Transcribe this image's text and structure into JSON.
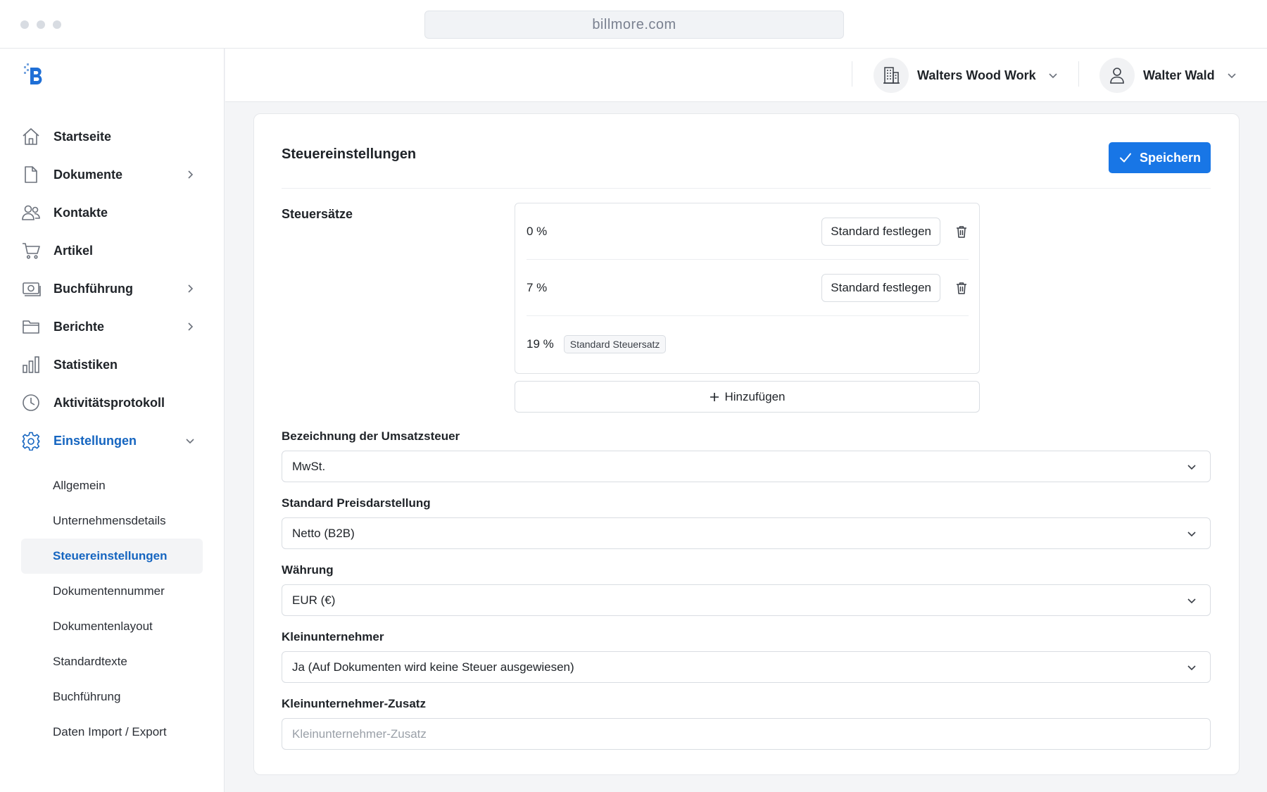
{
  "browser": {
    "url": "billmore.com"
  },
  "sidebar": {
    "logo": "billmore-logo",
    "items": [
      {
        "label": "Startseite",
        "icon": "home-icon"
      },
      {
        "label": "Dokumente",
        "icon": "document-icon",
        "expandable": true
      },
      {
        "label": "Kontakte",
        "icon": "contacts-icon"
      },
      {
        "label": "Artikel",
        "icon": "cart-icon"
      },
      {
        "label": "Buchführung",
        "icon": "money-icon",
        "expandable": true
      },
      {
        "label": "Berichte",
        "icon": "folder-icon",
        "expandable": true
      },
      {
        "label": "Statistiken",
        "icon": "bar-chart-icon"
      },
      {
        "label": "Aktivitätsprotokoll",
        "icon": "clock-icon"
      },
      {
        "label": "Einstellungen",
        "icon": "gear-icon",
        "expanded": true,
        "active": true
      }
    ],
    "subitems": [
      {
        "label": "Allgemein"
      },
      {
        "label": "Unternehmensdetails"
      },
      {
        "label": "Steuereinstellungen",
        "active": true
      },
      {
        "label": "Dokumentennummer"
      },
      {
        "label": "Dokumentenlayout"
      },
      {
        "label": "Standardtexte"
      },
      {
        "label": "Buchführung"
      },
      {
        "label": "Daten Import / Export"
      }
    ]
  },
  "header": {
    "company": {
      "name": "Walters Wood Work",
      "icon": "building-icon"
    },
    "user": {
      "name": "Walter Wald",
      "icon": "user-icon"
    }
  },
  "card": {
    "title": "Steuereinstellungen",
    "save_label": "Speichern",
    "tax_rates_label": "Steuersätze",
    "tax_rates": [
      {
        "value": "0 %",
        "action_label": "Standard festlegen"
      },
      {
        "value": "7 %",
        "action_label": "Standard festlegen"
      },
      {
        "value": "19 %",
        "badge": "Standard Steuersatz"
      }
    ],
    "add_label": "Hinzufügen",
    "fields": [
      {
        "label": "Bezeichnung der Umsatzsteuer",
        "value": "MwSt."
      },
      {
        "label": "Standard Preisdarstellung",
        "value": "Netto (B2B)"
      },
      {
        "label": "Währung",
        "value": "EUR (€)"
      },
      {
        "label": "Kleinunternehmer",
        "value": "Ja (Auf Dokumenten wird keine Steuer ausgewiesen)"
      }
    ],
    "extra_field": {
      "label": "Kleinunternehmer-Zusatz",
      "placeholder": "Kleinunternehmer-Zusatz",
      "value": ""
    }
  },
  "colors": {
    "accent": "#1876e6",
    "active_text": "#1565c0"
  }
}
